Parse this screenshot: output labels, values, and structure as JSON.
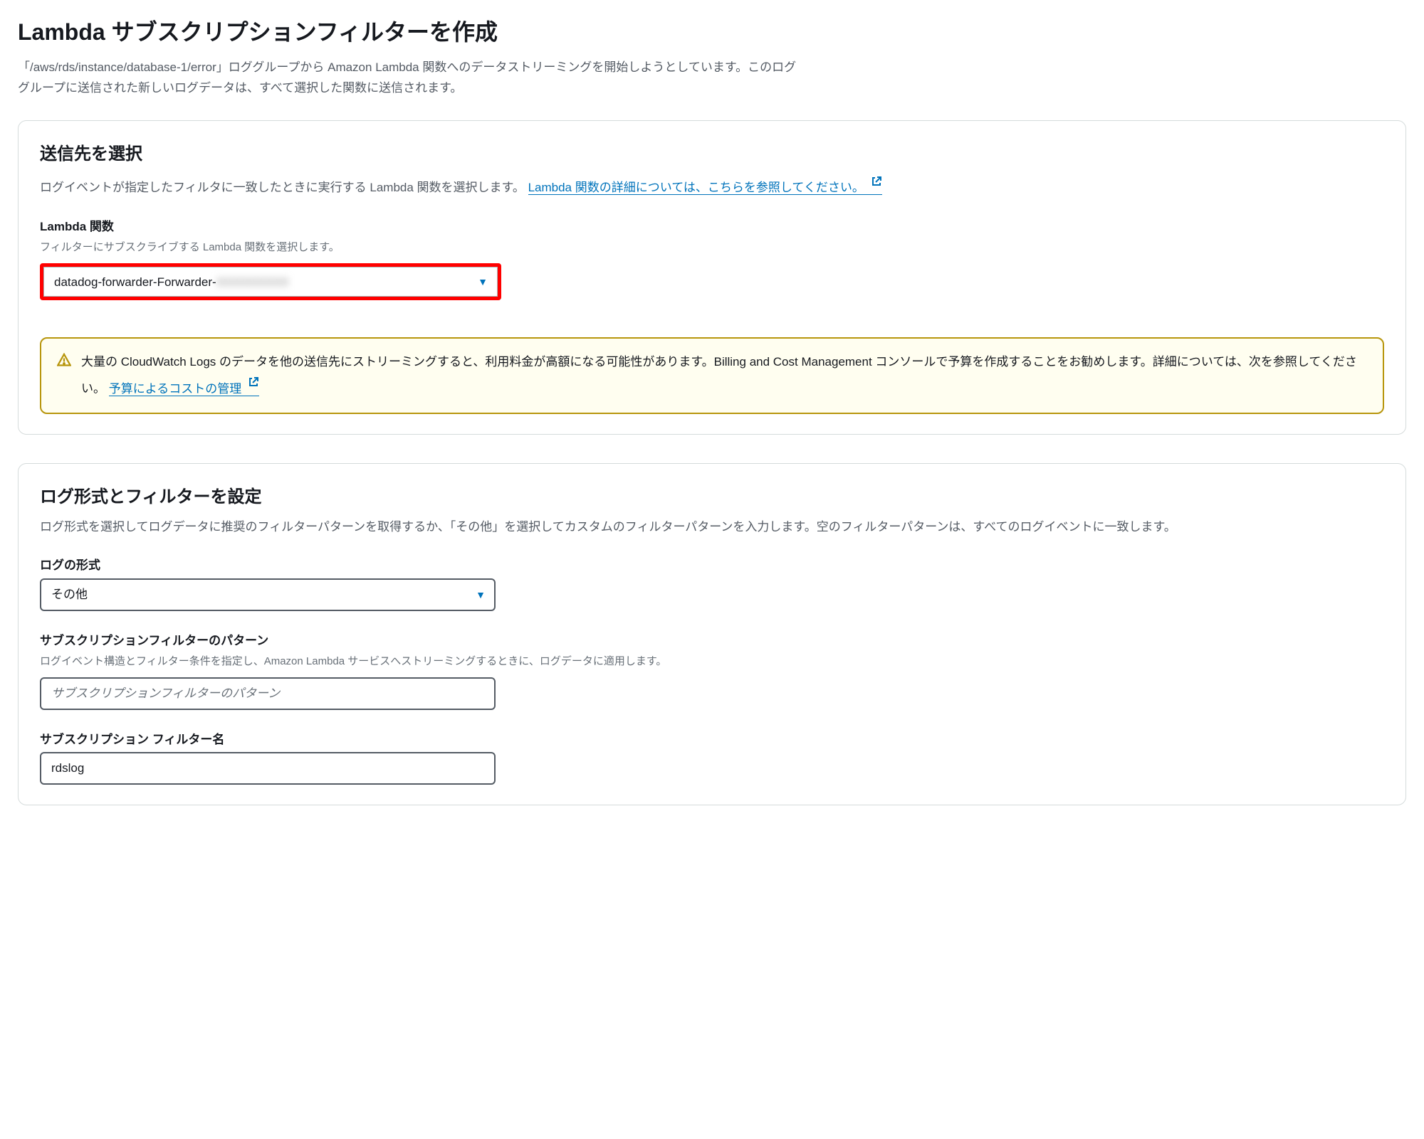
{
  "page": {
    "title": "Lambda サブスクリプションフィルターを作成",
    "description": "「/aws/rds/instance/database-1/error」ロググループから Amazon Lambda 関数へのデータストリーミングを開始しようとしています。このロググループに送信された新しいログデータは、すべて選択した関数に送信されます。"
  },
  "destination": {
    "title": "送信先を選択",
    "description_prefix": "ログイベントが指定したフィルタに一致したときに実行する Lambda 関数を選択します。 ",
    "link_text": "Lambda 関数の詳細については、こちらを参照してください。",
    "lambda_field_label": "Lambda 関数",
    "lambda_field_description": "フィルターにサブスクライブする Lambda 関数を選択します。",
    "lambda_selected_value": "datadog-forwarder-Forwarder-",
    "lambda_selected_value_redacted": "XXXXXXXXX"
  },
  "alert": {
    "text_prefix": "大量の CloudWatch Logs のデータを他の送信先にストリーミングすると、利用料金が高額になる可能性があります。Billing and Cost Management コンソールで予算を作成することをお勧めします。詳細については、次を参照してください。 ",
    "link_text": "予算によるコストの管理"
  },
  "config": {
    "title": "ログ形式とフィルターを設定",
    "description": "ログ形式を選択してログデータに推奨のフィルターパターンを取得するか、「その他」を選択してカスタムのフィルターパターンを入力します。空のフィルターパターンは、すべてのログイベントに一致します。",
    "log_format_label": "ログの形式",
    "log_format_value": "その他",
    "filter_pattern_label": "サブスクリプションフィルターのパターン",
    "filter_pattern_description": "ログイベント構造とフィルター条件を指定し、Amazon Lambda サービスへストリーミングするときに、ログデータに適用します。",
    "filter_pattern_placeholder": "サブスクリプションフィルターのパターン",
    "filter_name_label": "サブスクリプション フィルター名",
    "filter_name_value": "rdslog"
  }
}
